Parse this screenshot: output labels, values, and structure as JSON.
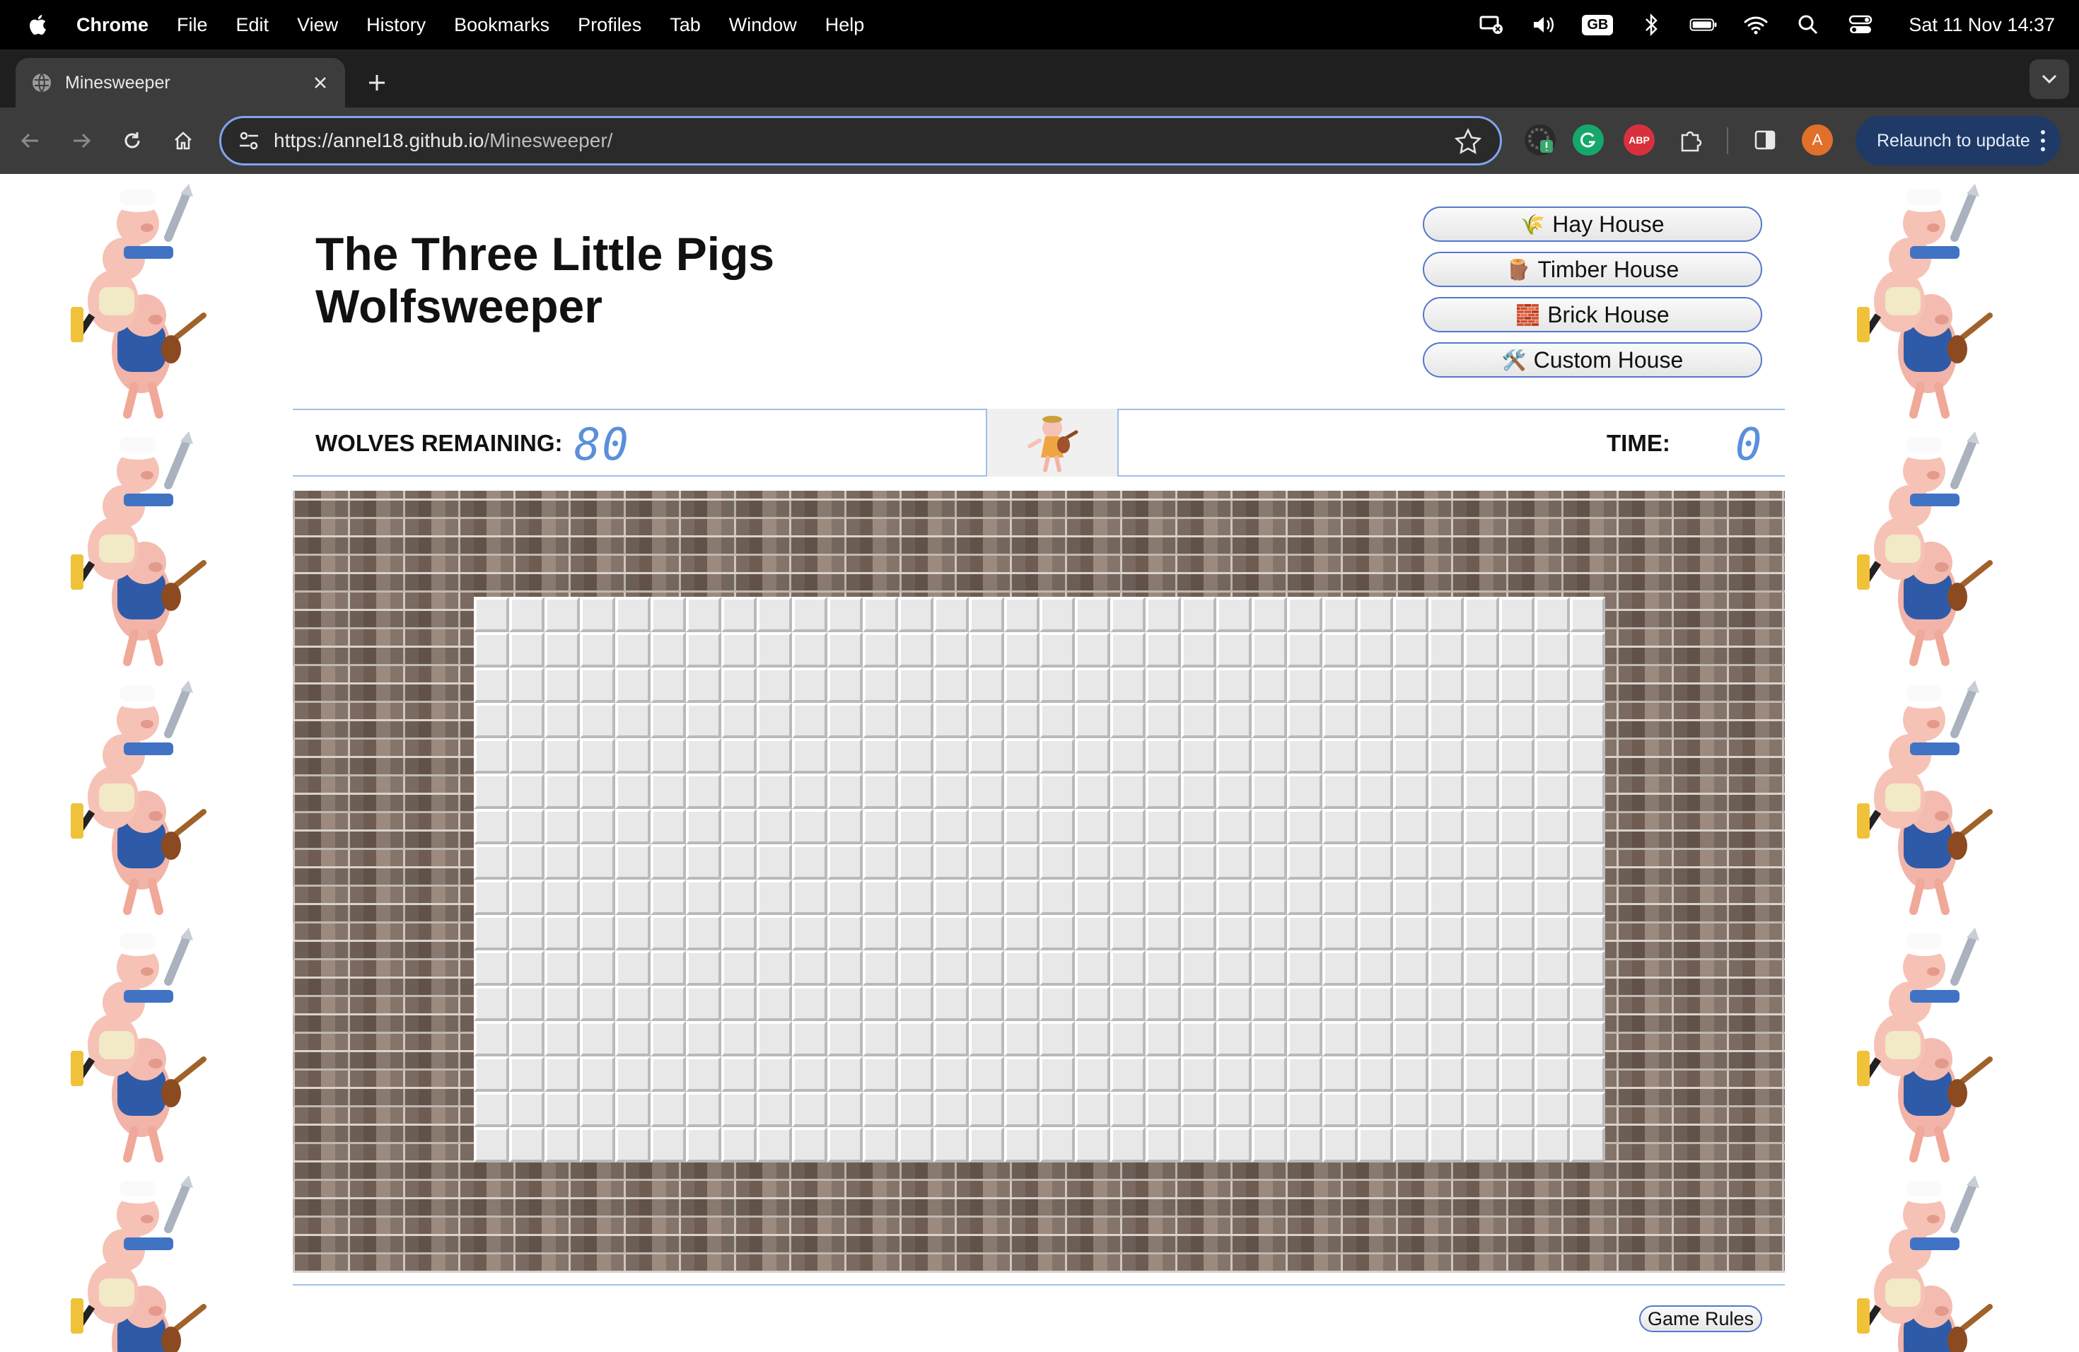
{
  "menubar": {
    "app": "Chrome",
    "items": [
      "File",
      "Edit",
      "View",
      "History",
      "Bookmarks",
      "Profiles",
      "Tab",
      "Window",
      "Help"
    ],
    "input_source": "GB",
    "clock": "Sat 11 Nov  14:37"
  },
  "browser": {
    "tab_title": "Minesweeper",
    "url_host": "https://annel18.github.io",
    "url_path": "/Minesweeper/",
    "relaunch_label": "Relaunch to update",
    "profile_initial": "A",
    "abp_label": "ABP"
  },
  "game": {
    "title_line1": "The Three Little Pigs",
    "title_line2": "Wolfsweeper",
    "levels": [
      {
        "icon": "🌾",
        "label": "Hay House"
      },
      {
        "icon": "🪵",
        "label": "Timber House"
      },
      {
        "icon": "🧱",
        "label": "Brick House"
      },
      {
        "icon": "🛠️",
        "label": "Custom House"
      }
    ],
    "wolves_label": "WOLVES REMAINING:",
    "wolves_value": "80",
    "time_label": "TIME:",
    "time_value": "0",
    "rules_label": "Game Rules",
    "board_cols": 32,
    "board_rows": 16
  },
  "colors": {
    "accent": "#7fa5f0",
    "digit": "#5a8fdb",
    "divider": "#9ec1e8"
  }
}
